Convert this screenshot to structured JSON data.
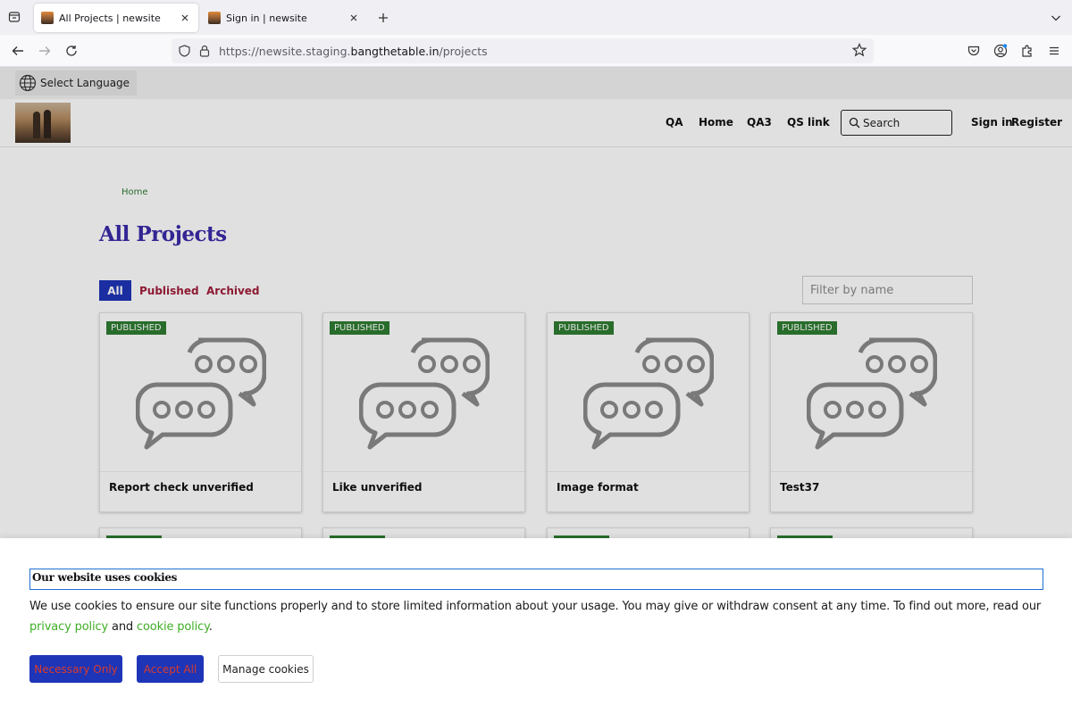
{
  "browser": {
    "tabs": [
      {
        "title": "All Projects | newsite"
      },
      {
        "title": "Sign in | newsite"
      }
    ],
    "url": {
      "prefix": "https://newsite.staging.",
      "host": "bangthetable.in",
      "path": "/projects"
    }
  },
  "language": {
    "label": "Select Language"
  },
  "header": {
    "nav": [
      "QA",
      "Home",
      "QA3",
      "QS link"
    ],
    "search_label": "Search",
    "sign_in": "Sign in",
    "register": "Register"
  },
  "breadcrumb": {
    "home": "Home"
  },
  "page": {
    "title": "All Projects"
  },
  "filters": {
    "tabs": [
      "All",
      "Published",
      "Archived"
    ],
    "name_placeholder": "Filter by name"
  },
  "projects": [
    {
      "status": "PUBLISHED",
      "title": "Report check unverified"
    },
    {
      "status": "PUBLISHED",
      "title": "Like unverified"
    },
    {
      "status": "PUBLISHED",
      "title": "Image format"
    },
    {
      "status": "PUBLISHED",
      "title": "Test37"
    }
  ],
  "cookies": {
    "title": "Our website uses cookies",
    "text": "We use cookies to ensure our site functions properly and to store limited information about your usage. You may give or withdraw consent at any time. To find out more, read our ",
    "privacy_link": "privacy policy",
    "and": " and ",
    "cookie_link": "cookie policy",
    "period": ".",
    "buttons": {
      "necessary": "Necessary Only",
      "accept": "Accept All",
      "manage": "Manage cookies"
    }
  },
  "colors": {
    "primary_blue": "#1e35b8",
    "title_purple": "#3a2ba8",
    "status_green": "#2e7d32",
    "link_green": "#3fae26",
    "filter_red": "#a01e3a"
  }
}
